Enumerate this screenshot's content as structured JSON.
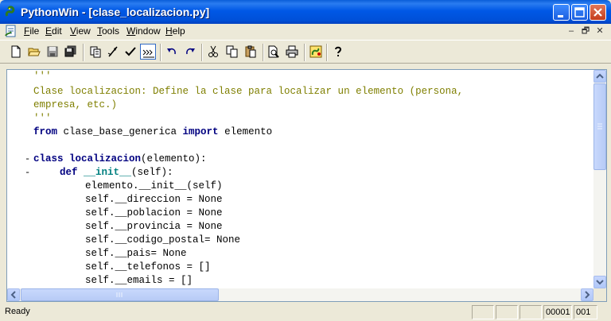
{
  "window": {
    "title": "PythonWin - [clase_localizacion.py]"
  },
  "title_buttons": [
    "minimize-icon",
    "maximize-icon",
    "close-icon"
  ],
  "menu": [
    {
      "label": "File",
      "accel": "F",
      "rest": "ile"
    },
    {
      "label": "Edit",
      "accel": "E",
      "rest": "dit"
    },
    {
      "label": "View",
      "accel": "V",
      "rest": "iew"
    },
    {
      "label": "Tools",
      "accel": "T",
      "rest": "ools"
    },
    {
      "label": "Window",
      "accel": "W",
      "rest": "indow"
    },
    {
      "label": "Help",
      "accel": "H",
      "rest": "elp"
    }
  ],
  "mdi_controls": [
    "–",
    "🗗",
    "✕"
  ],
  "toolbar": [
    "new-file-icon",
    "open-folder-icon",
    "save-icon",
    "save-all-icon",
    "copy-format-icon",
    "run-icon",
    "check-icon",
    "indent-icon",
    "undo-icon",
    "redo-icon",
    "cut-icon",
    "copy-icon",
    "paste-icon",
    "print-preview-icon",
    "print-icon",
    "debug-icon",
    "help-icon"
  ],
  "code": {
    "line1": "'''",
    "line2": "Clase localizacion: Define la clase para localizar un elemento (persona,",
    "line3": "empresa, etc.)",
    "line4": "'''",
    "line5_kw1": "from",
    "line5_mid": " clase_base_generica ",
    "line5_kw2": "import",
    "line5_end": " elemento",
    "line7_kw": "class",
    "line7_name": "localizacion",
    "line7_end": "(elemento):",
    "line8_kw": "def",
    "line8_name": "__init__",
    "line8_end": "(self):",
    "line9": "elemento.__init__(self)",
    "line10": "self.__direccion = None",
    "line11": "self.__poblacion = None",
    "line12": "self.__provincia = None",
    "line13": "self.__codigo_postal= None",
    "line14": "self.__pais= None",
    "line15": "self.__telefonos = []",
    "line16": "self.__emails = []",
    "fold_marker": "-"
  },
  "status": {
    "text": "Ready",
    "line": "00001",
    "col": "001"
  }
}
